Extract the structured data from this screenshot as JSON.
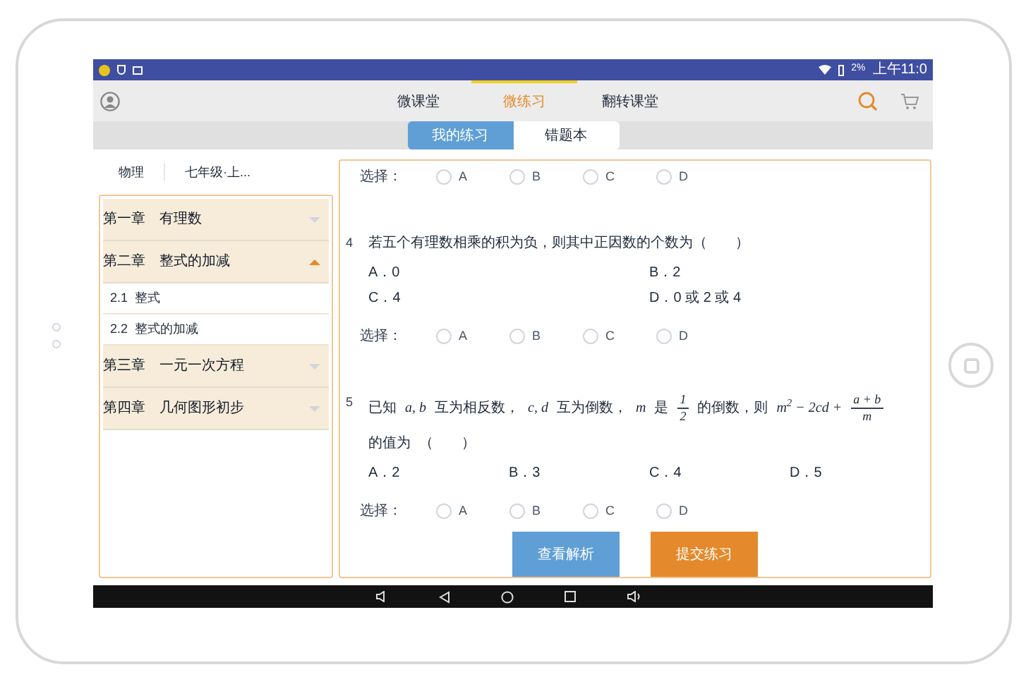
{
  "status_bar": {
    "battery": "2%",
    "time": "上午11:0"
  },
  "nav_tabs": [
    {
      "label": "微课堂",
      "selected": false
    },
    {
      "label": "微练习",
      "selected": true
    },
    {
      "label": "翻转课堂",
      "selected": false
    }
  ],
  "sub_tabs": [
    {
      "label": "我的练习",
      "selected": true
    },
    {
      "label": "错题本",
      "selected": false
    }
  ],
  "filters": [
    "物理",
    "七年级·上..."
  ],
  "chapters": [
    {
      "label": "第一章　有理数",
      "expanded": false
    },
    {
      "label": "第二章　整式的加减",
      "expanded": true,
      "children": [
        {
          "label": "2.1  整式"
        },
        {
          "label": "2.2  整式的加减"
        }
      ]
    },
    {
      "label": "第三章　一元一次方程",
      "expanded": false
    },
    {
      "label": "第四章　几何图形初步",
      "expanded": false
    }
  ],
  "questions": [
    {
      "select_label": "选择：",
      "choices": [
        {
          "label": "A",
          "selected": false
        },
        {
          "label": "B",
          "selected": false
        },
        {
          "label": "C",
          "selected": false
        },
        {
          "label": "D",
          "selected": false
        }
      ]
    },
    {
      "number": "4",
      "parts": [
        {
          "kind": "text",
          "text": "若五个有理数相乘的积为负，则其中正因数的个数为（　　）"
        }
      ],
      "kind": "pairs",
      "options": [
        "A．0",
        "B．2",
        "C．4",
        "D．0 或 2 或 4"
      ],
      "select_label": "选择：",
      "choices": [
        {
          "label": "A",
          "selected": false
        },
        {
          "label": "B",
          "selected": false
        },
        {
          "label": "C",
          "selected": false
        },
        {
          "label": "D",
          "selected": false
        }
      ]
    },
    {
      "number": "5",
      "parts": [
        {
          "kind": "text",
          "text": "已知"
        },
        {
          "kind": "math",
          "text": "a, b"
        },
        {
          "kind": "text",
          "text": "互为相反数，"
        },
        {
          "kind": "math",
          "text": "c, d"
        },
        {
          "kind": "text",
          "text": "互为倒数，"
        },
        {
          "kind": "math",
          "text": "m"
        },
        {
          "kind": "text",
          "text": "是"
        },
        {
          "kind": "frac",
          "num": "1",
          "den": "2"
        },
        {
          "kind": "text",
          "text": "的倒数，则"
        },
        {
          "kind": "math",
          "text": "m$^{2}$ − 2cd +"
        },
        {
          "kind": "frac",
          "num": "a + b",
          "den": "m"
        },
        {
          "kind": "text",
          "text": "的值为"
        },
        {
          "kind": "text",
          "text": "（　　）"
        }
      ],
      "kind": "row",
      "options": [
        "A．2",
        "B．3",
        "C．4",
        "D．5"
      ],
      "select_label": "选择：",
      "choices": [
        {
          "label": "A",
          "selected": false
        },
        {
          "label": "B",
          "selected": false
        },
        {
          "label": "C",
          "selected": false
        },
        {
          "label": "D",
          "selected": false
        }
      ]
    }
  ],
  "buttons": [
    {
      "label": "查看解析",
      "kind": "secondary"
    },
    {
      "label": "提交练习",
      "kind": "primary"
    }
  ]
}
